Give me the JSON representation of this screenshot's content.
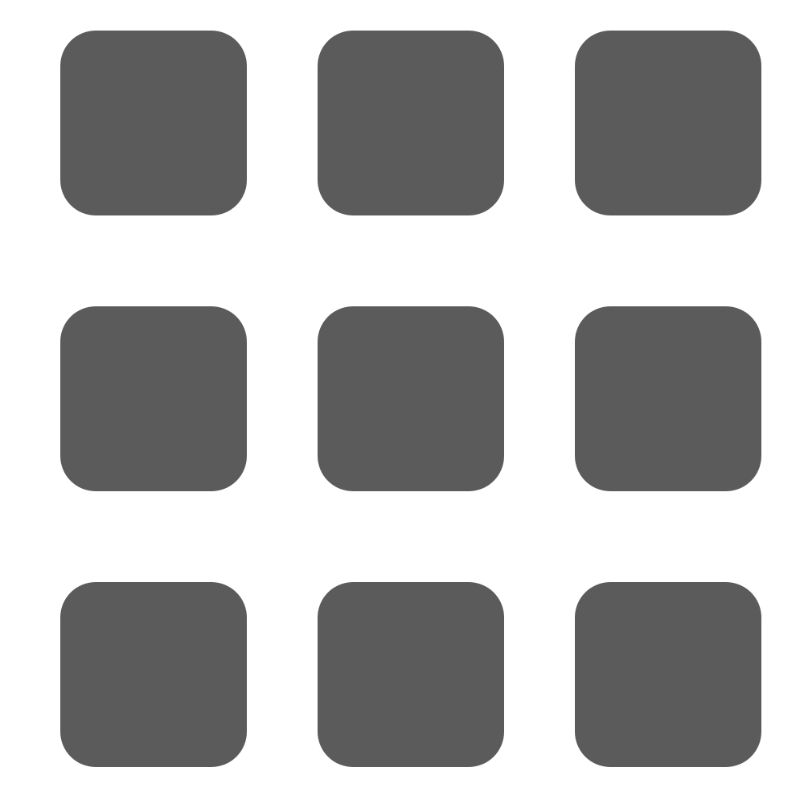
{
  "icon": {
    "name": "app-grid-icon",
    "tile_color": "#5b5b5b",
    "background_color": "#ffffff"
  }
}
